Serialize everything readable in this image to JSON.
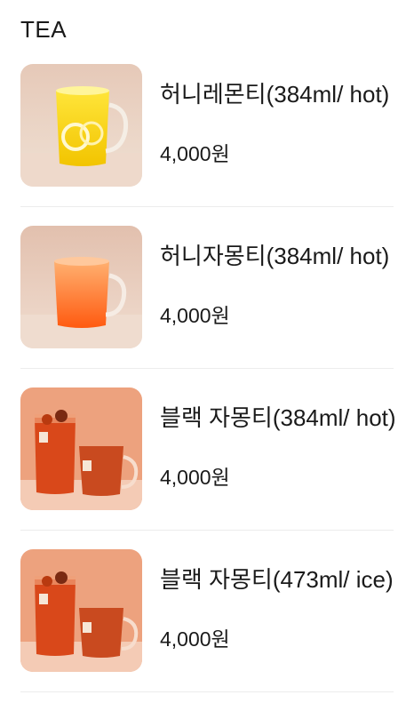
{
  "section": {
    "title": "TEA"
  },
  "items": [
    {
      "name": "허니레몬티(384ml/ hot)",
      "price": "4,000원",
      "image": "honey-lemon-tea-image"
    },
    {
      "name": "허니자몽티(384ml/ hot)",
      "price": "4,000원",
      "image": "honey-grapefruit-tea-image"
    },
    {
      "name": "블랙 자몽티(384ml/ hot)",
      "price": "4,000원",
      "image": "black-grapefruit-tea-hot-image"
    },
    {
      "name": "블랙 자몽티(473ml/ ice)",
      "price": "4,000원",
      "image": "black-grapefruit-tea-ice-image"
    }
  ]
}
